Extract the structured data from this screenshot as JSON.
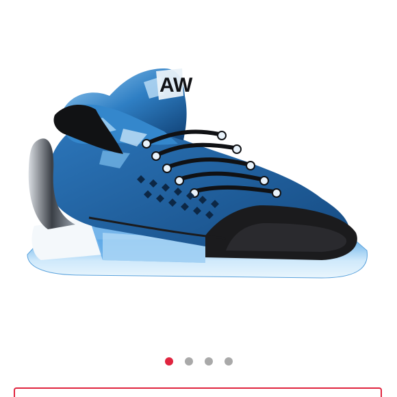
{
  "carousel": {
    "image_icon": "sneaker-photo",
    "slide_count": 4,
    "active_index": 0
  },
  "colors": {
    "active_dot": "#e0243f",
    "inactive_dot": "#a9a9a9",
    "panel_border": "#e0243f",
    "shoe_upper": "#1f5f9e",
    "shoe_sole": "#8fc8f0",
    "shoe_trim": "#1c1c1c"
  }
}
